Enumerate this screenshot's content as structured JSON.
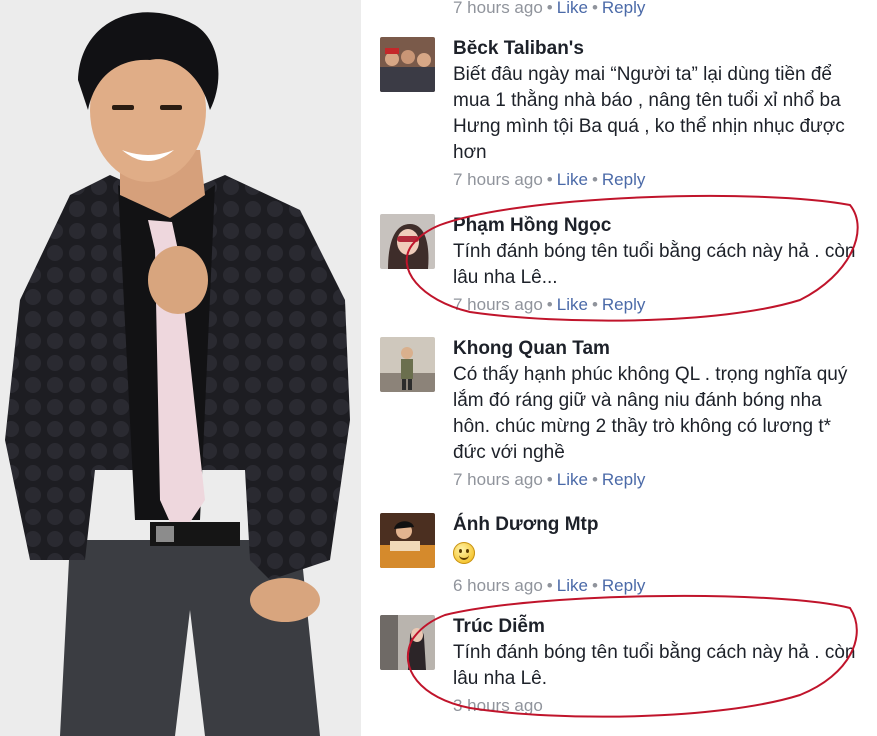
{
  "top_meta": {
    "time": "7 hours ago",
    "like": "Like",
    "reply": "Reply",
    "sep": "•"
  },
  "comments": [
    {
      "name": "Bĕck Taliban's",
      "text": "Biết đâu ngày mai “Người ta” lại dùng tiền để mua 1 thằng nhà báo , nâng tên tuổi xỉ nhổ ba Hưng mình tội Ba quá , ko thể nhịn nhục được hơn",
      "time": "7 hours ago",
      "like": "Like",
      "reply": "Reply"
    },
    {
      "name": "Phạm Hồng Ngọc",
      "text": "Tính đánh bóng tên tuổi bằng cách này hả . còn lâu nha Lê...",
      "time": "7 hours ago",
      "like": "Like",
      "reply": "Reply"
    },
    {
      "name": "Khong Quan Tam",
      "text": "Có thấy hạnh phúc không QL . trọng nghĩa quý lắm đó ráng giữ và nâng niu đánh bóng nha hôn. chúc mừng 2 thầy trò không có lương t* đức với nghề",
      "time": "7 hours ago",
      "like": "Like",
      "reply": "Reply"
    },
    {
      "name": "Ánh Dương Mtp",
      "text": "",
      "time": "6 hours ago",
      "like": "Like",
      "reply": "Reply"
    },
    {
      "name": "Trúc Diễm",
      "text": "Tính đánh bóng tên tuổi bằng cách này hả . còn lâu nha Lê.",
      "time": "3 hours ago",
      "like": "",
      "reply": ""
    }
  ],
  "colors": {
    "name": "#1d2129",
    "meta": "#90949c",
    "link": "#4b6aa8",
    "circle": "#c0142b"
  }
}
